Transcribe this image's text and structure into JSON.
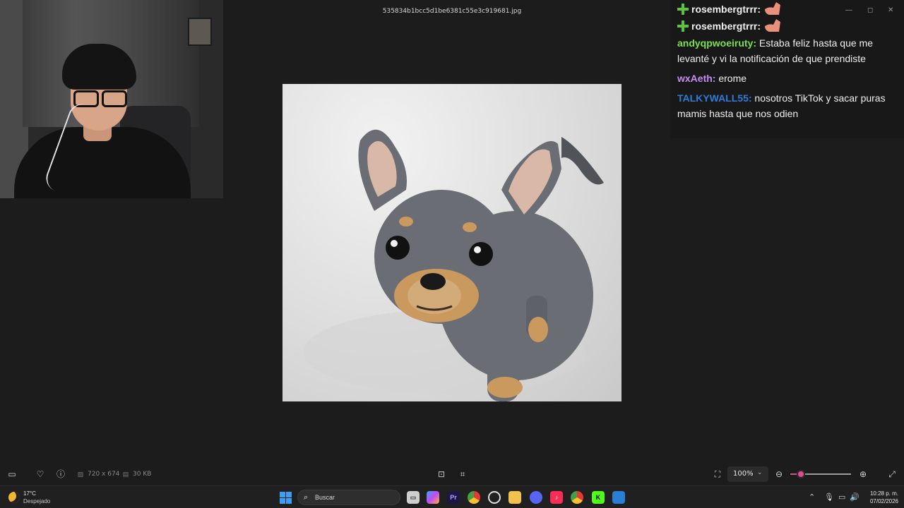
{
  "viewer": {
    "file_name": "535834b1bcc5d1be6381c55e3c919681.jpg",
    "dimensions": "720 x 674",
    "file_size": "30 KB",
    "zoom": "100%",
    "zoom_level": 0.18
  },
  "chat": {
    "messages": [
      {
        "user": "rosembergtrrr:",
        "text": "",
        "user_color": "#7ee04a",
        "badge": "green-cross-badge",
        "emote": true
      },
      {
        "user": "rosembergtrrr:",
        "text": "",
        "user_color": "#7ee04a",
        "badge": "green-cross-badge",
        "emote": true
      },
      {
        "user": "andyqpwoeiruty:",
        "text": "Estaba feliz hasta que me levanté y vi la notificación de que prendiste",
        "user_color": "#7ee04a"
      },
      {
        "user": "wxAeth:",
        "text": "erome",
        "user_color": "#c68cf2"
      },
      {
        "user": "TALKYWALL55:",
        "text": "nosotros TikTok y sacar puras mamis hasta que nos odien",
        "user_color": "#2f7bd8"
      }
    ]
  },
  "taskbar": {
    "weather_temp": "17°C",
    "weather_desc": "Despejado",
    "search_placeholder": "Buscar",
    "time": "10:28 p. m.",
    "date": "07/02/2026"
  },
  "colors": {
    "accent": "#e24a8f",
    "chat_bg": "#181818",
    "viewer_bg": "#1c1c1c",
    "taskbar_bg": "#202020"
  }
}
